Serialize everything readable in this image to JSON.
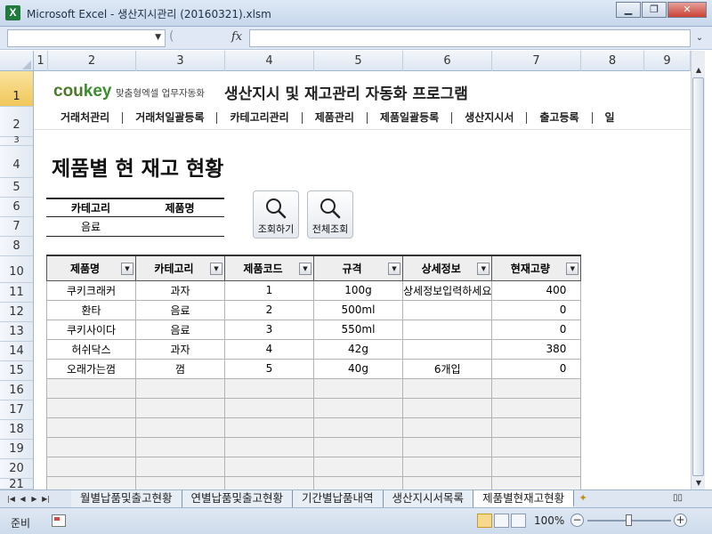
{
  "window": {
    "title": "Microsoft Excel - 생산지시관리 (20160321).xlsm",
    "app_icon": "excel-icon",
    "buttons": [
      "minimize-icon",
      "restore-icon",
      "close-icon"
    ]
  },
  "formula_bar": {
    "name_box": "",
    "fx_label": "fx",
    "formula": ""
  },
  "columns": [
    "1",
    "2",
    "3",
    "4",
    "5",
    "6",
    "7",
    "8",
    "9"
  ],
  "rows": [
    "1",
    "2",
    "3",
    "4",
    "5",
    "6",
    "7",
    "8",
    "10",
    "11",
    "12",
    "13",
    "14",
    "15",
    "16",
    "17",
    "18",
    "19",
    "20",
    "21"
  ],
  "header": {
    "logo_main": "cou",
    "logo_key": "key",
    "logo_sub": "맞춤형엑셀 업무자동화",
    "program_title": "생산지시 및 재고관리 자동화 프로그램"
  },
  "menu": [
    "거래처관리",
    "거래처일괄등록",
    "카테고리관리",
    "제품관리",
    "제품일괄등록",
    "생산지시서",
    "출고등록",
    "일"
  ],
  "page_title": "제품별 현 재고 현황",
  "filter": {
    "category_label": "카테고리",
    "product_label": "제품명",
    "category_value": "음료",
    "product_value": ""
  },
  "buttons": {
    "search": "조회하기",
    "search_all": "전체조회"
  },
  "table": {
    "headers": [
      "제품명",
      "카테고리",
      "제품코드",
      "규격",
      "상세정보",
      "현재고량"
    ],
    "rows": [
      [
        "쿠키크래커",
        "과자",
        "1",
        "100g",
        "상세정보입력하세요",
        "400"
      ],
      [
        "환타",
        "음료",
        "2",
        "500ml",
        "",
        "0"
      ],
      [
        "쿠키사이다",
        "음료",
        "3",
        "550ml",
        "",
        "0"
      ],
      [
        "허쉬닥스",
        "과자",
        "4",
        "42g",
        "",
        "380"
      ],
      [
        "오래가는껌",
        "껌",
        "5",
        "40g",
        "6개입",
        "0"
      ]
    ],
    "empty_rows": 6
  },
  "sheet_tabs": [
    "월별납품및출고현황",
    "연별납품및출고현황",
    "기간별납품내역",
    "생산지시서목록",
    "제품별현재고현황"
  ],
  "active_tab": "제품별현재고현황",
  "status": {
    "ready": "준비",
    "zoom": "100%"
  },
  "colors": {
    "logo_green": "#4a7a2a",
    "selected_row_header": "#f1c75a",
    "title_bar": "#c7d7ec"
  }
}
